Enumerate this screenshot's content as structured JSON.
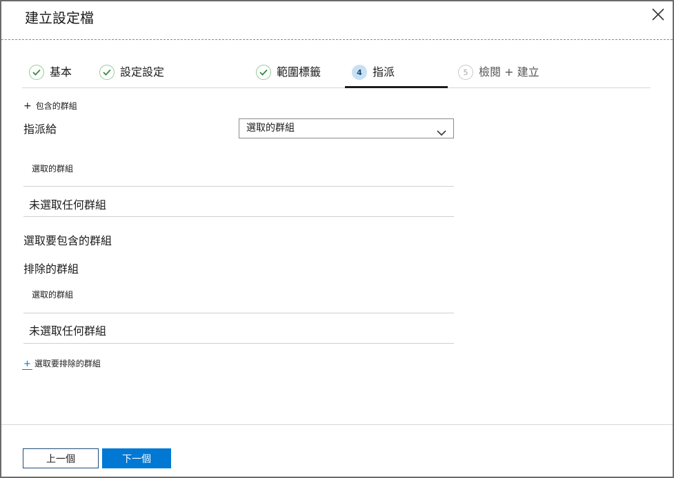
{
  "dialog": {
    "title": "建立設定檔"
  },
  "steps": [
    {
      "label": "基本",
      "state": "done",
      "icon": "check-icon"
    },
    {
      "label": "設定設定",
      "state": "done",
      "icon": "check-icon"
    },
    {
      "label": "範圍標籤",
      "state": "done",
      "icon": "check-icon"
    },
    {
      "number": "4",
      "label": "指派",
      "state": "active"
    },
    {
      "number": "5",
      "label": "檢閱 + 建立",
      "state": "pending"
    }
  ],
  "included": {
    "add_link": "包含的群組",
    "assign_label": "指派給",
    "dropdown_value": "選取的群組",
    "table_header": "選取的群組",
    "empty_text": "未選取任何群組",
    "select_link": "選取要包含的群組"
  },
  "excluded": {
    "title": "排除的群組",
    "table_header": "選取的群組",
    "empty_text": "未選取任何群組",
    "select_link": "選取要排除的群組"
  },
  "footer": {
    "prev_label": "上一個",
    "next_label": "下一個"
  },
  "colors": {
    "accent": "#0078d4",
    "check": "#2e8b3d",
    "dashed_separator": "#3aa0c8"
  }
}
